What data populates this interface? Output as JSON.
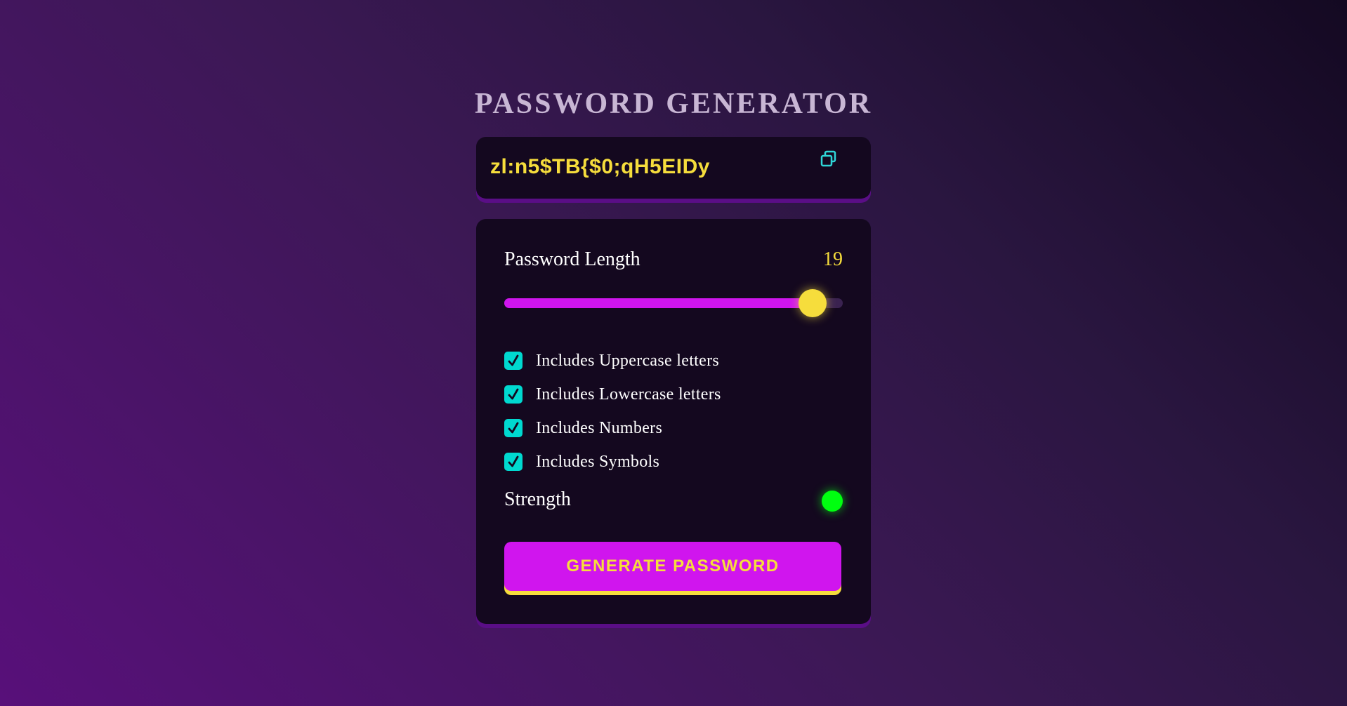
{
  "app": {
    "title": "PASSWORD GENERATOR"
  },
  "display": {
    "password": "zl:n5$TB{$0;qH5EIDy",
    "copy_icon": "copy-icon"
  },
  "length": {
    "label": "Password Length",
    "value": "19",
    "slider_fraction": 0.91
  },
  "options": [
    {
      "label": "Includes Uppercase letters",
      "checked": true
    },
    {
      "label": "Includes Lowercase letters",
      "checked": true
    },
    {
      "label": "Includes Numbers",
      "checked": true
    },
    {
      "label": "Includes Symbols",
      "checked": true
    }
  ],
  "strength": {
    "label": "Strength",
    "indicator_color": "#00ff10"
  },
  "generate_button": {
    "label": "GENERATE PASSWORD"
  },
  "colors": {
    "accent": "#d015ee",
    "highlight": "#f6dd3c",
    "checkbox": "#00d9d0",
    "panel": "#14081f"
  }
}
